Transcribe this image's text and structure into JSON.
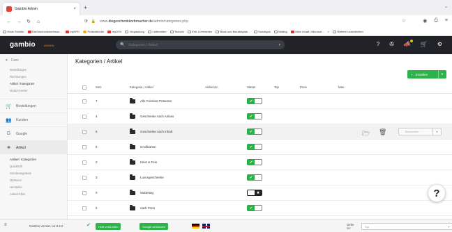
{
  "browser": {
    "tab_title": "Gambio Admin",
    "tab_close": "×",
    "new_tab": "+",
    "tab_overflow": "⌄",
    "nav_back": "←",
    "nav_forward": "→",
    "nav_reload": "↻",
    "nav_home": "⌂",
    "url_prefix": "www.",
    "url_domain": "diegeschenkkorbmacher.de",
    "url_path": "/admin/categories.php",
    "bookmarks": [
      {
        "label": "Erste Schritte",
        "icon": "plain"
      },
      {
        "label": "DieGeschenkkorbmac...",
        "icon": "red"
      },
      {
        "label": "myDPD",
        "icon": "red"
      },
      {
        "label": "Präsentkörbe",
        "icon": "yellow"
      },
      {
        "label": "myDSV",
        "icon": "red"
      },
      {
        "label": "Verpackung",
        "icon": "plain"
      },
      {
        "label": "Lieferanten",
        "icon": "plain"
      },
      {
        "label": "Technik",
        "icon": "plain"
      },
      {
        "label": "Entl. Lieferanten",
        "icon": "plain"
      },
      {
        "label": "Bank und Bezahlsyste...",
        "icon": "plain"
      },
      {
        "label": "Sonstiges",
        "icon": "plain"
      },
      {
        "label": "Mailing",
        "icon": "plain"
      },
      {
        "label": "Mein Inhalt | Microsof...",
        "icon": "red"
      },
      {
        "label": "»",
        "icon": "none"
      },
      {
        "label": "Weitere Lesezeichen",
        "icon": "plain"
      }
    ]
  },
  "header": {
    "logo": "gambio",
    "logo_sub": "ADMIN",
    "search_placeholder": "Kategorien / Artikel"
  },
  "sidebar": {
    "favorites": "Favs",
    "favorite_items": [
      "Bestellungen",
      "Rechnungen",
      "Artikel / Kategorien",
      "Modul-Center"
    ],
    "active_favorite": "Artikel / Kategorien",
    "main_items": [
      {
        "label": "Bestellungen",
        "icon": "cart-icon",
        "glyph": "🛒"
      },
      {
        "label": "Kunden",
        "icon": "users-icon",
        "glyph": "👥"
      },
      {
        "label": "Google",
        "icon": "google-icon",
        "glyph": "G"
      },
      {
        "label": "Artikel",
        "icon": "sitemap-icon",
        "glyph": "♣"
      }
    ],
    "artikel_subitems": [
      "Artikel / Kategorien",
      "QuickEdit",
      "Sonderangebote",
      "Optionen",
      "Hersteller",
      "Artikel-Filter"
    ]
  },
  "main": {
    "title": "Kategorien / Artikel",
    "create_label": "Erstellen",
    "columns": [
      "Sort.",
      "Kategorie / Artikel",
      "Artikel-Nr.",
      "Status",
      "Top",
      "Preis",
      "Max."
    ],
    "rows": [
      {
        "sort": "7",
        "name": "Alle Feinkost Präsente",
        "active": true
      },
      {
        "sort": "4",
        "name": "Geschenke nach Anlass",
        "active": true
      },
      {
        "sort": "5",
        "name": "Geschenke nach Inhalt",
        "active": true
      },
      {
        "sort": "8",
        "name": "Großkarton",
        "active": true
      },
      {
        "sort": "2",
        "name": "Klein & Fein",
        "active": true
      },
      {
        "sort": "3",
        "name": "Luxusgeschenke",
        "active": true
      },
      {
        "sort": "0",
        "name": "Muttertag",
        "active": false
      },
      {
        "sort": "6",
        "name": "nach Preis",
        "active": true
      }
    ],
    "edit_label": "Bearbeiten",
    "toggle_on": "✔",
    "toggle_off": "✖"
  },
  "footer": {
    "version": "Gambio Version: v4.9.4.2",
    "btn_hub": "HUB verbunden",
    "btn_google": "Google verbunden",
    "goto_label": "Gehe zu:",
    "goto_value": "Top"
  }
}
